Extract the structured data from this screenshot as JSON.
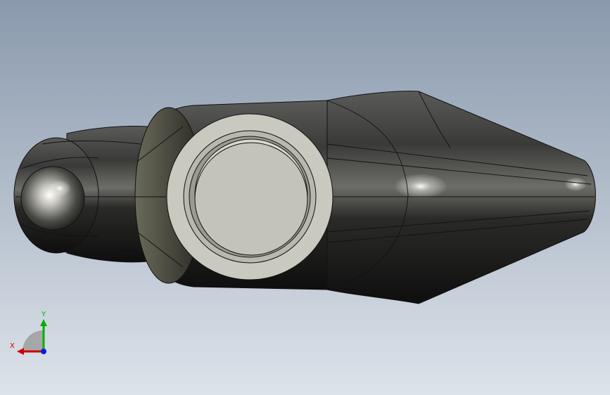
{
  "viewport": {
    "background_top": "#8a99ad",
    "background_bottom": "#dde3ea"
  },
  "model": {
    "body_color": "#2e2e2e",
    "face_color": "#c9c9c0",
    "edge_color": "#111111"
  },
  "triad": {
    "x_label": "X",
    "y_label": "Y",
    "x_color": "#d00000",
    "y_color": "#00b000",
    "z_color": "#0020e0"
  }
}
